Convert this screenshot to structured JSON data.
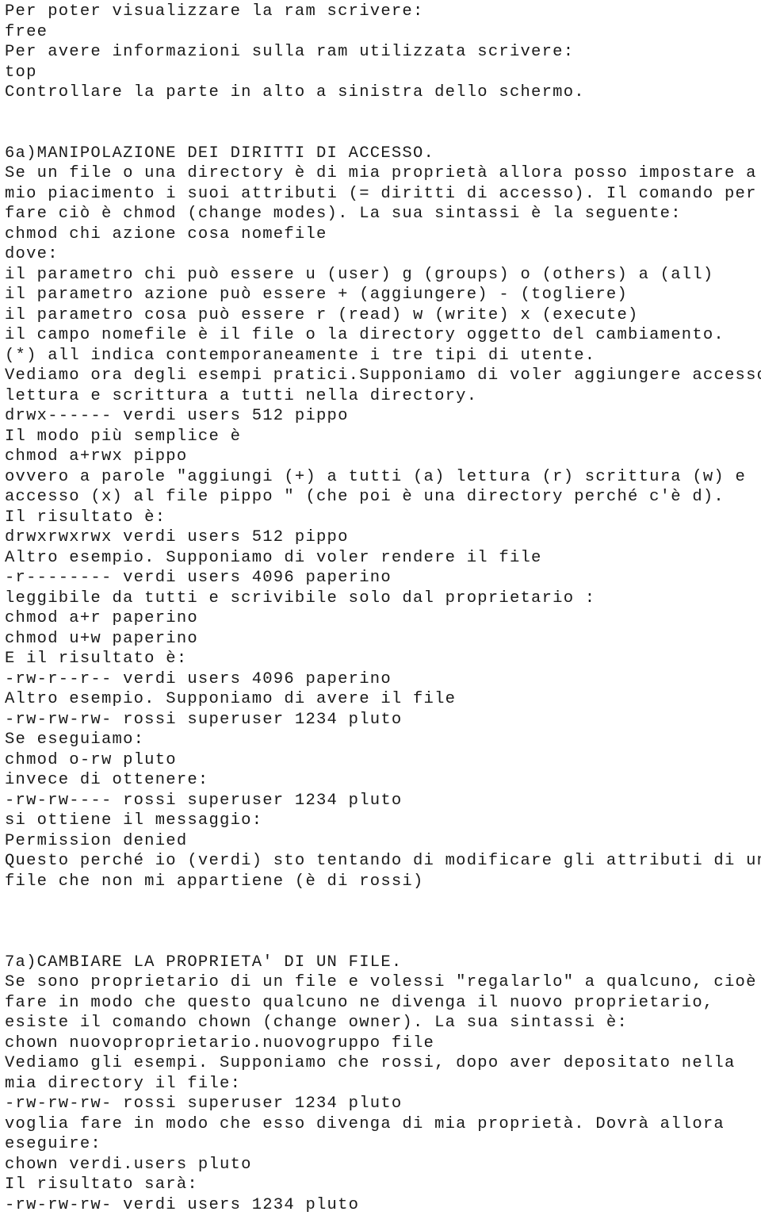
{
  "document": {
    "language": "it",
    "text_color": "#1a1a1a",
    "background_color": "#ffffff",
    "sections": [
      {
        "id": "ram-commands",
        "lines": [
          "Per poter visualizzare la ram scrivere:",
          "free",
          "Per avere informazioni sulla ram utilizzata scrivere:",
          "top",
          "Controllare la parte in alto a sinistra dello schermo.",
          "",
          ""
        ]
      },
      {
        "id": "section-6a",
        "heading": "6a)MANIPOLAZIONE DEI DIRITTI DI ACCESSO.",
        "lines": [
          "6a)MANIPOLAZIONE DEI DIRITTI DI ACCESSO.",
          "Se un file o una directory è di mia proprietà allora posso impostare a",
          "mio piacimento i suoi attributi (= diritti di accesso). Il comando per",
          "fare ciò è chmod (change modes). La sua sintassi è la seguente:",
          "chmod chi azione cosa nomefile",
          "dove:",
          "il parametro chi può essere u (user) g (groups) o (others) a (all)",
          "il parametro azione può essere + (aggiungere) - (togliere)",
          "il parametro cosa può essere r (read) w (write) x (execute)",
          "il campo nomefile è il file o la directory oggetto del cambiamento.",
          "(*) all indica contemporaneamente i tre tipi di utente.",
          "Vediamo ora degli esempi pratici.Supponiamo di voler aggiungere accesso,",
          "lettura e scrittura a tutti nella directory.",
          "drwx------ verdi users 512 pippo",
          "Il modo più semplice è",
          "chmod a+rwx pippo",
          "ovvero a parole \"aggiungi (+) a tutti (a) lettura (r) scrittura (w) e",
          "accesso (x) al file pippo \" (che poi è una directory perché c'è d).",
          "Il risultato è:",
          "drwxrwxrwx verdi users 512 pippo",
          "Altro esempio. Supponiamo di voler rendere il file",
          "-r-------- verdi users 4096 paperino",
          "leggibile da tutti e scrivibile solo dal proprietario :",
          "chmod a+r paperino",
          "chmod u+w paperino",
          "E il risultato è:",
          "-rw-r--r-- verdi users 4096 paperino",
          "Altro esempio. Supponiamo di avere il file",
          "-rw-rw-rw- rossi superuser 1234 pluto",
          "Se eseguiamo:",
          "chmod o-rw pluto",
          "invece di ottenere:",
          "-rw-rw---- rossi superuser 1234 pluto",
          "si ottiene il messaggio:",
          "Permission denied",
          "Questo perché io (verdi) sto tentando di modificare gli attributi di un",
          "file che non mi appartiene (è di rossi)",
          "",
          "",
          ""
        ]
      },
      {
        "id": "section-7a",
        "heading": "7a)CAMBIARE LA PROPRIETA' DI UN FILE.",
        "lines": [
          "7a)CAMBIARE LA PROPRIETA' DI UN FILE.",
          "Se sono proprietario di un file e volessi \"regalarlo\" a qualcuno, cioè",
          "fare in modo che questo qualcuno ne divenga il nuovo proprietario,",
          "esiste il comando chown (change owner). La sua sintassi è:",
          "chown nuovoproprietario.nuovogruppo file",
          "Vediamo gli esempi. Supponiamo che rossi, dopo aver depositato nella",
          "mia directory il file:",
          "-rw-rw-rw- rossi superuser 1234 pluto",
          "voglia fare in modo che esso divenga di mia proprietà. Dovrà allora",
          "eseguire:",
          "chown verdi.users pluto",
          "Il risultato sarà:",
          "-rw-rw-rw- verdi users 1234 pluto"
        ]
      }
    ]
  }
}
